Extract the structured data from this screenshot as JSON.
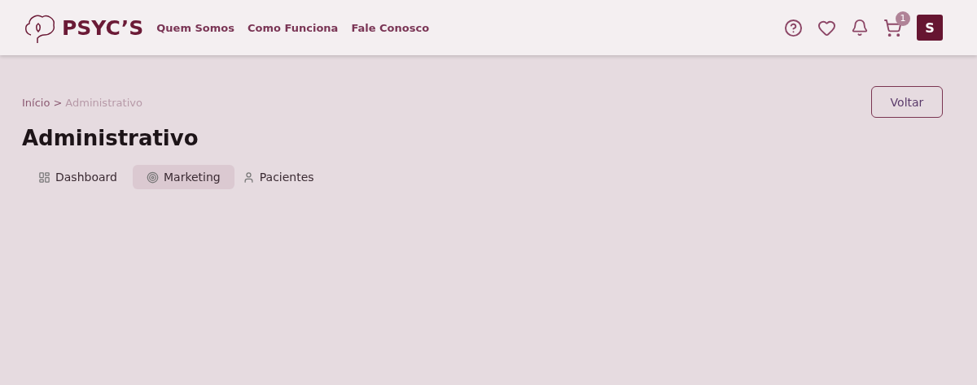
{
  "header": {
    "logo": "PSYC’S",
    "nav": [
      "Quem Somos",
      "Como Funciona",
      "Fale Conosco"
    ],
    "cart_count": "1",
    "avatar": "S"
  },
  "breadcrumb": [
    {
      "label": "Início",
      "current": false
    },
    {
      "label": ">",
      "current": false
    },
    {
      "label": "Administrativo",
      "current": true
    }
  ],
  "back_button": "Voltar",
  "title": "Administrativo",
  "tabs": [
    {
      "label": "Dashboard",
      "kind": "grid",
      "selected": false
    },
    {
      "label": "Marketing",
      "kind": "target",
      "selected": true
    },
    {
      "label": "Pacientes",
      "kind": "user",
      "selected": false
    }
  ]
}
